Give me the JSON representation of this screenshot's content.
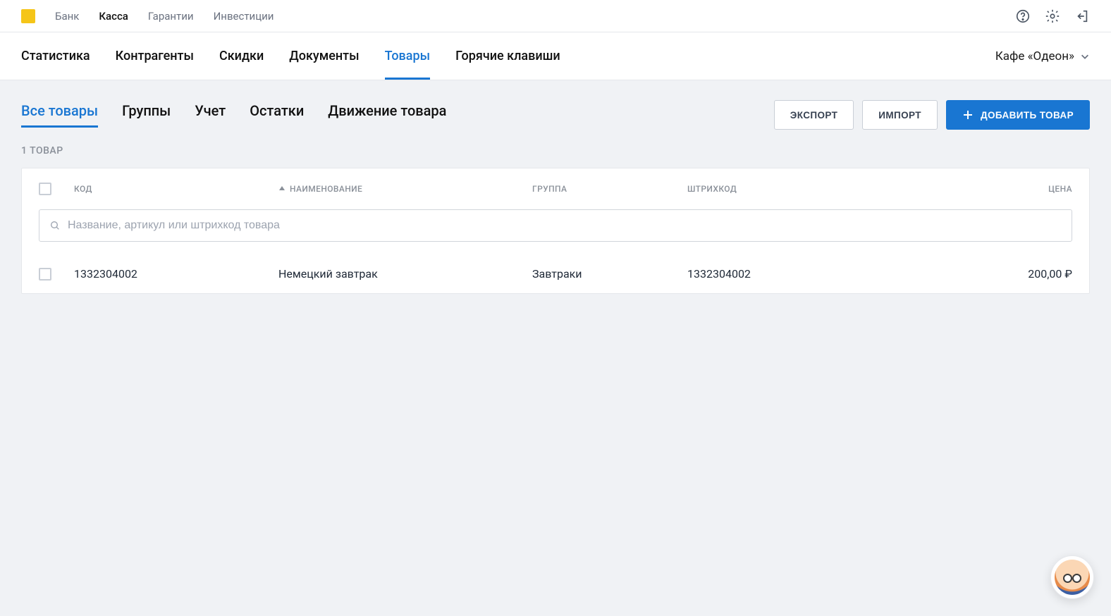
{
  "top_nav": {
    "items": [
      {
        "label": "Банк",
        "active": false
      },
      {
        "label": "Касса",
        "active": true
      },
      {
        "label": "Гарантии",
        "active": false
      },
      {
        "label": "Инвестиции",
        "active": false
      }
    ]
  },
  "top_icons": {
    "help": "help-icon",
    "settings": "gear-icon",
    "logout": "logout-icon"
  },
  "sub_nav": {
    "items": [
      {
        "label": "Статистика",
        "active": false
      },
      {
        "label": "Контрагенты",
        "active": false
      },
      {
        "label": "Скидки",
        "active": false
      },
      {
        "label": "Документы",
        "active": false
      },
      {
        "label": "Товары",
        "active": true
      },
      {
        "label": "Горячие клавиши",
        "active": false
      }
    ]
  },
  "organization": {
    "name": "Кафе «Одеон»"
  },
  "filter_tabs": {
    "items": [
      {
        "label": "Все товары",
        "active": true
      },
      {
        "label": "Группы",
        "active": false
      },
      {
        "label": "Учет",
        "active": false
      },
      {
        "label": "Остатки",
        "active": false
      },
      {
        "label": "Движение товара",
        "active": false
      }
    ]
  },
  "actions": {
    "export": "ЭКСПОРТ",
    "import": "ИМПОРТ",
    "add": "ДОБАВИТЬ ТОВАР"
  },
  "count_label": "1 ТОВАР",
  "table": {
    "headers": {
      "code": "КОД",
      "name": "НАИМЕНОВАНИЕ",
      "group": "ГРУППА",
      "barcode": "ШТРИХКОД",
      "price": "ЦЕНА"
    },
    "search_placeholder": "Название, артикул или штрихкод товара",
    "rows": [
      {
        "code": "1332304002",
        "name": "Немецкий завтрак",
        "group": "Завтраки",
        "barcode": "1332304002",
        "price": "200,00 ₽"
      }
    ]
  }
}
